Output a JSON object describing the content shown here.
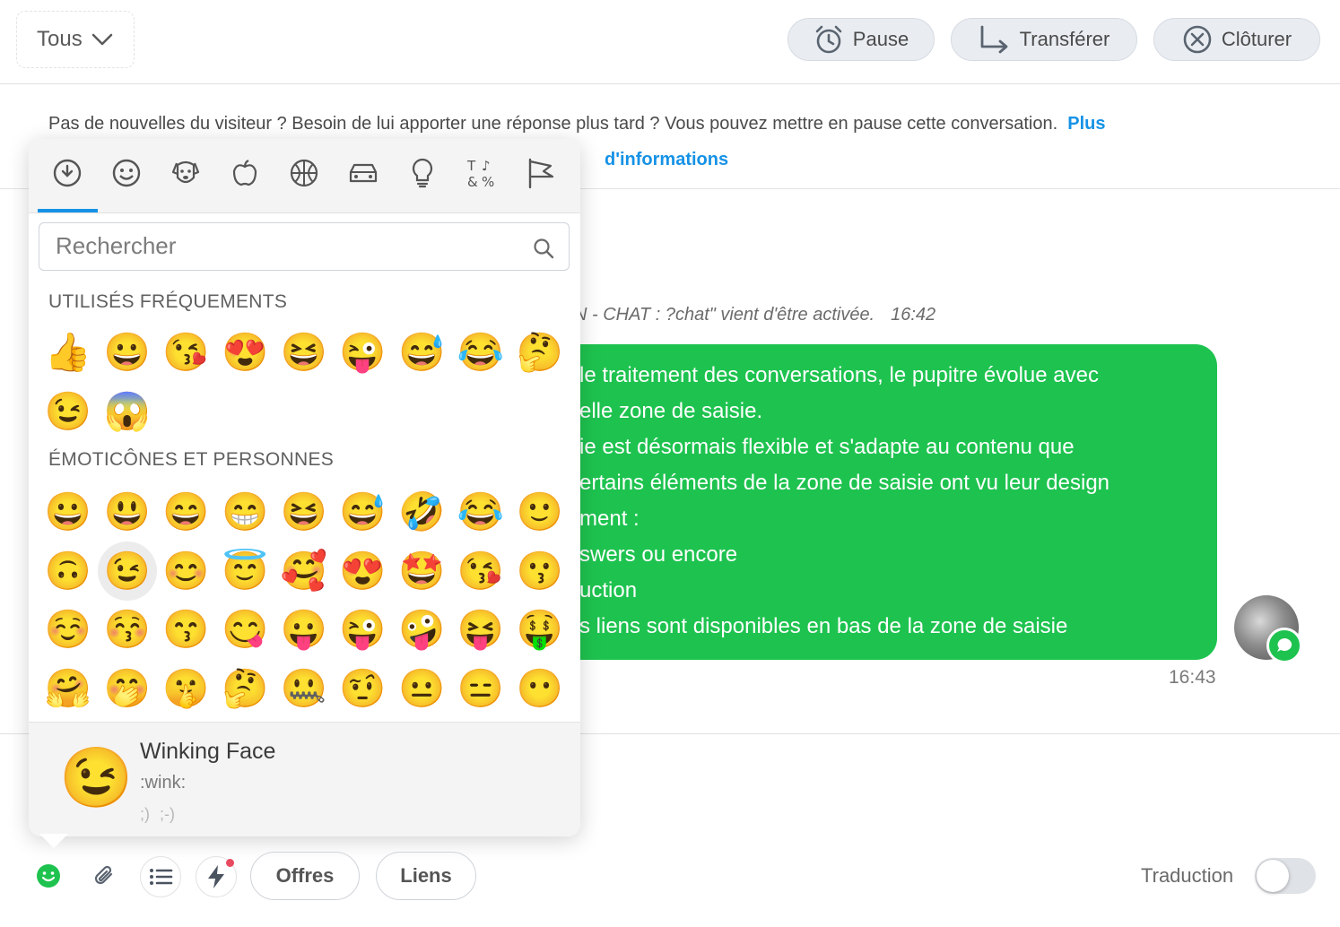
{
  "header": {
    "filter_label": "Tous",
    "buttons": {
      "pause": "Pause",
      "transfer": "Transférer",
      "close": "Clôturer"
    }
  },
  "banner": {
    "text": "Pas de nouvelles du visiteur ? Besoin de lui apporter une réponse plus tard ? Vous pouvez mettre en pause cette conversation.",
    "link_part1": "Plus",
    "link_part2": "d'informations"
  },
  "chat": {
    "system_message": "N - CHAT : ?chat\" vient d'être activée.",
    "system_time": "16:42",
    "message_lines": [
      "le traitement des conversations, le pupitre évolue avec",
      "elle zone de saisie.",
      "ie est désormais flexible et s'adapte au contenu que",
      "ertains éléments de la zone de saisie ont vu leur design",
      "ment :",
      "swers ou encore",
      "uction",
      "s liens sont disponibles en bas de la zone de saisie"
    ],
    "message_time": "16:43"
  },
  "emoji_picker": {
    "categories": [
      "recent-icon",
      "smileys-icon",
      "animals-icon",
      "food-icon",
      "activity-icon",
      "travel-icon",
      "objects-icon",
      "symbols-icon",
      "flags-icon"
    ],
    "search_placeholder": "Rechercher",
    "sections": {
      "frequent": {
        "title": "UTILISÉS FRÉQUEMENTS",
        "emojis": [
          "👍",
          "😀",
          "😘",
          "😍",
          "😆",
          "😜",
          "😅",
          "😂",
          "🤔",
          "😉",
          "😱"
        ]
      },
      "people": {
        "title": "ÉMOTICÔNES ET PERSONNES",
        "emojis": [
          "😀",
          "😃",
          "😄",
          "😁",
          "😆",
          "😅",
          "🤣",
          "😂",
          "🙂",
          "🙃",
          "😉",
          "😊",
          "😇",
          "🥰",
          "😍",
          "🤩",
          "😘",
          "😗",
          "☺️",
          "😚",
          "😙",
          "😋",
          "😛",
          "😜",
          "🤪",
          "😝",
          "🤑",
          "🤗",
          "🤭",
          "🤫",
          "🤔",
          "🤐",
          "🤨",
          "😐",
          "😑",
          "😶"
        ]
      }
    },
    "preview": {
      "emoji": "😉",
      "name": "Winking Face",
      "shortcode": ":wink:",
      "aliases": ";) ;-)"
    }
  },
  "toolbar": {
    "offers": "Offres",
    "links": "Liens",
    "translation_label": "Traduction",
    "translation_enabled": false
  },
  "colors": {
    "accent": "#1592e6",
    "bubble": "#1ec34f",
    "pill_bg": "#e9edf2"
  }
}
